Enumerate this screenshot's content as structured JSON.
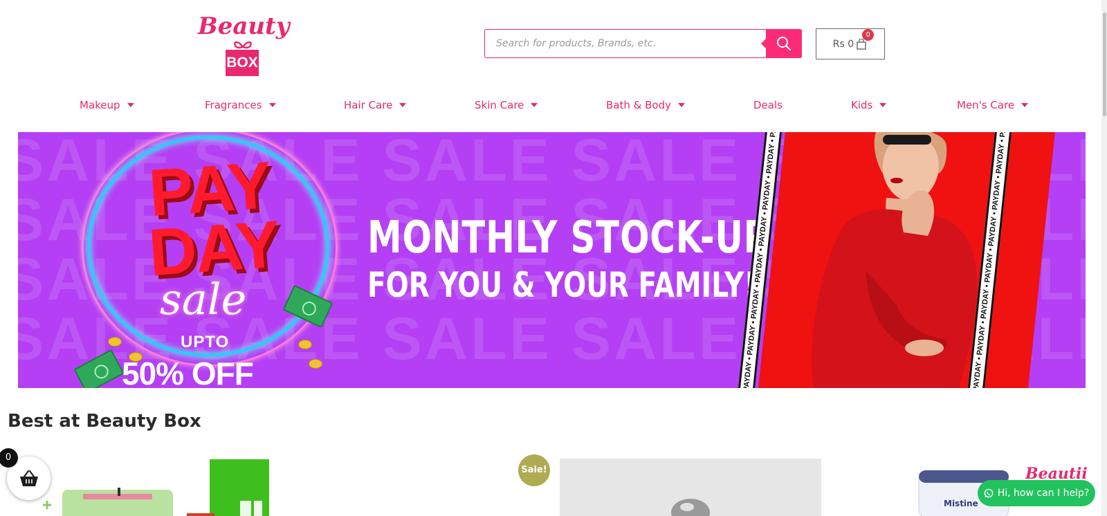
{
  "logo": {
    "script_text": "Beauty",
    "box_text": "BOX"
  },
  "search": {
    "placeholder": "Search for products, Brands, etc.",
    "value": ""
  },
  "cart": {
    "total": "Rs 0",
    "count": "0"
  },
  "nav": {
    "items": [
      {
        "label": "Makeup",
        "has_dropdown": true
      },
      {
        "label": "Fragrances",
        "has_dropdown": true
      },
      {
        "label": "Hair Care",
        "has_dropdown": true
      },
      {
        "label": "Skin Care",
        "has_dropdown": true
      },
      {
        "label": "Bath & Body",
        "has_dropdown": true
      },
      {
        "label": "Deals",
        "has_dropdown": false
      },
      {
        "label": "Kids",
        "has_dropdown": true
      },
      {
        "label": "Men's Care",
        "has_dropdown": true
      }
    ]
  },
  "banner": {
    "pay_line1": "PAY",
    "pay_line2": "DAY",
    "sale_script": "sale",
    "upto": "UPTO",
    "discount": "50% OFF",
    "headline_line1": "MONTHLY STOCK-UP",
    "headline_line2": "FOR YOU & YOUR FAMILY!",
    "watermark": "SALE SALE SALE SALE SALE SALE SALE SALE",
    "strip_text": "PAYDAY • PAYDAY • PAYDAY • PAYDAY • PAYDAY • PAYDAY • PAYDAY • PAYDAY"
  },
  "section": {
    "title": "Best at Beauty Box"
  },
  "products": {
    "sale_badge": "Sale!",
    "brand_watermark": "Beautii"
  },
  "basket": {
    "count": "0"
  },
  "whatsapp": {
    "label": "Hi, how can I help?"
  },
  "colors": {
    "brand_pink": "#e8286f",
    "banner_purple": "#b43ff4",
    "whatsapp_green": "#22c35e"
  }
}
